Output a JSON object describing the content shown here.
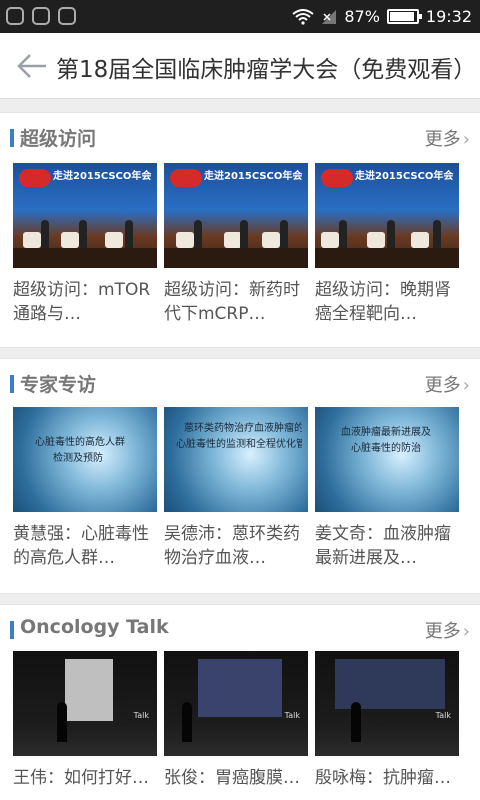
{
  "status_bar": {
    "battery_percent": "87%",
    "battery_level": 0.87,
    "time": "19:32",
    "left_icons": [
      "notification-icon",
      "notification-icon",
      "image-notification-icon"
    ]
  },
  "header": {
    "title": "第18届全国临床肿瘤学大会（免费观看）"
  },
  "sections": [
    {
      "title": "超级访问",
      "more_label": "更多",
      "items": [
        {
          "title": "超级访问：mTOR通路与…"
        },
        {
          "title": "超级访问：新药时代下mCRP…"
        },
        {
          "title": "超级访问：晚期肾癌全程靶向…"
        }
      ],
      "thumbnail_banner": "走进2015CSCO年会"
    },
    {
      "title": "专家专访",
      "more_label": "更多",
      "items": [
        {
          "title": "黄慧强：心脏毒性的高危人群…",
          "slide_line1": "心脏毒性的高危人群",
          "slide_line2": "检测及预防"
        },
        {
          "title": "吴德沛：蒽环类药物治疗血液…",
          "slide_line1": "蒽环类药物治疗血液肿瘤的",
          "slide_line2": "心脏毒性的监测和全程优化管理"
        },
        {
          "title": "姜文奇：血液肿瘤最新进展及…",
          "slide_line1": "血液肿瘤最新进展及",
          "slide_line2": "心脏毒性的防治"
        }
      ]
    },
    {
      "title": "Oncology Talk",
      "more_label": "更多",
      "items": [
        {
          "title": "王伟：如何打好…"
        },
        {
          "title": "张俊：胃癌腹膜…"
        },
        {
          "title": "殷咏梅：抗肿瘤…"
        }
      ],
      "thumbnail_label": "Talk"
    }
  ],
  "colors": {
    "accent": "#3a7fc9",
    "status_bar_bg": "#1f1f1f"
  }
}
